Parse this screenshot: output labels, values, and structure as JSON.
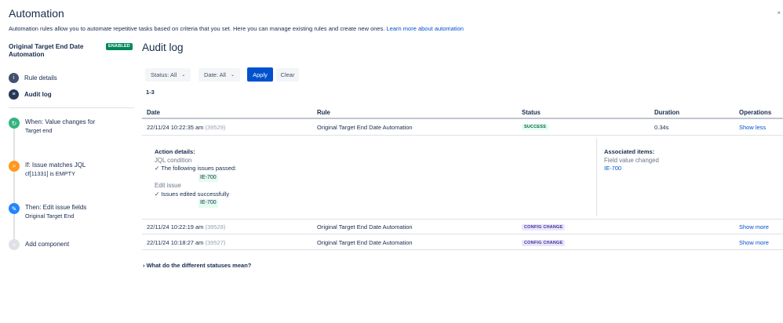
{
  "header": {
    "title": "Automation",
    "intro": "Automation rules allow you to automate repetitive tasks based on criteria that you set. Here you can manage existing rules and create new ones.",
    "learn_more": "Learn more about automation"
  },
  "sidebar": {
    "rule_name": "Original Target End Date Automation",
    "status_badge": "ENABLED",
    "nav": [
      {
        "label": "Rule details",
        "icon": "info-icon"
      },
      {
        "label": "Audit log",
        "icon": "audit-log-icon"
      }
    ],
    "components": [
      {
        "title": "When: Value changes for",
        "detail": "Target end",
        "icon": "trigger-icon",
        "color": "#36b37e"
      },
      {
        "title": "If: Issue matches JQL",
        "detail": "cf[11331] is EMPTY",
        "icon": "condition-icon",
        "color": "#ff991f"
      },
      {
        "title": "Then: Edit issue fields",
        "detail": "Original Target End",
        "icon": "action-icon",
        "color": "#2684ff"
      },
      {
        "title": "Add component",
        "detail": "",
        "icon": "add-icon",
        "color": "#dfe1e6"
      }
    ]
  },
  "main": {
    "title": "Audit log",
    "filters": {
      "status": "Status: All",
      "date": "Date: All",
      "apply": "Apply",
      "clear": "Clear"
    },
    "range": "1-3",
    "columns": [
      "Date",
      "Rule",
      "Status",
      "Duration",
      "Operations"
    ],
    "rows": [
      {
        "date": "22/11/24 10:22:35 am",
        "id": "(39529)",
        "rule": "Original Target End Date Automation",
        "status": "SUCCESS",
        "duration": "0.34s",
        "op": "Show less"
      },
      {
        "date": "22/11/24 10:22:19 am",
        "id": "(39528)",
        "rule": "Original Target End Date Automation",
        "status": "CONFIG CHANGE",
        "duration": "",
        "op": "Show more"
      },
      {
        "date": "22/11/24 10:18:27 am",
        "id": "(39527)",
        "rule": "Original Target End Date Automation",
        "status": "CONFIG CHANGE",
        "duration": "",
        "op": "Show more"
      }
    ],
    "details": {
      "action_head": "Action details:",
      "jql_label": "JQL condition",
      "jql_result": "The following issues passed:",
      "jql_issue": "IE-700",
      "edit_label": "Edit issue",
      "edit_result": "Issues edited successfully",
      "edit_issue": "IE-700",
      "assoc_head": "Associated items:",
      "assoc_label": "Field value changed",
      "assoc_issue": "IE-700"
    },
    "faq": "What do the different statuses mean?"
  },
  "colors": {
    "primary": "#0052cc",
    "success": "#00875a",
    "config": "#403294"
  }
}
